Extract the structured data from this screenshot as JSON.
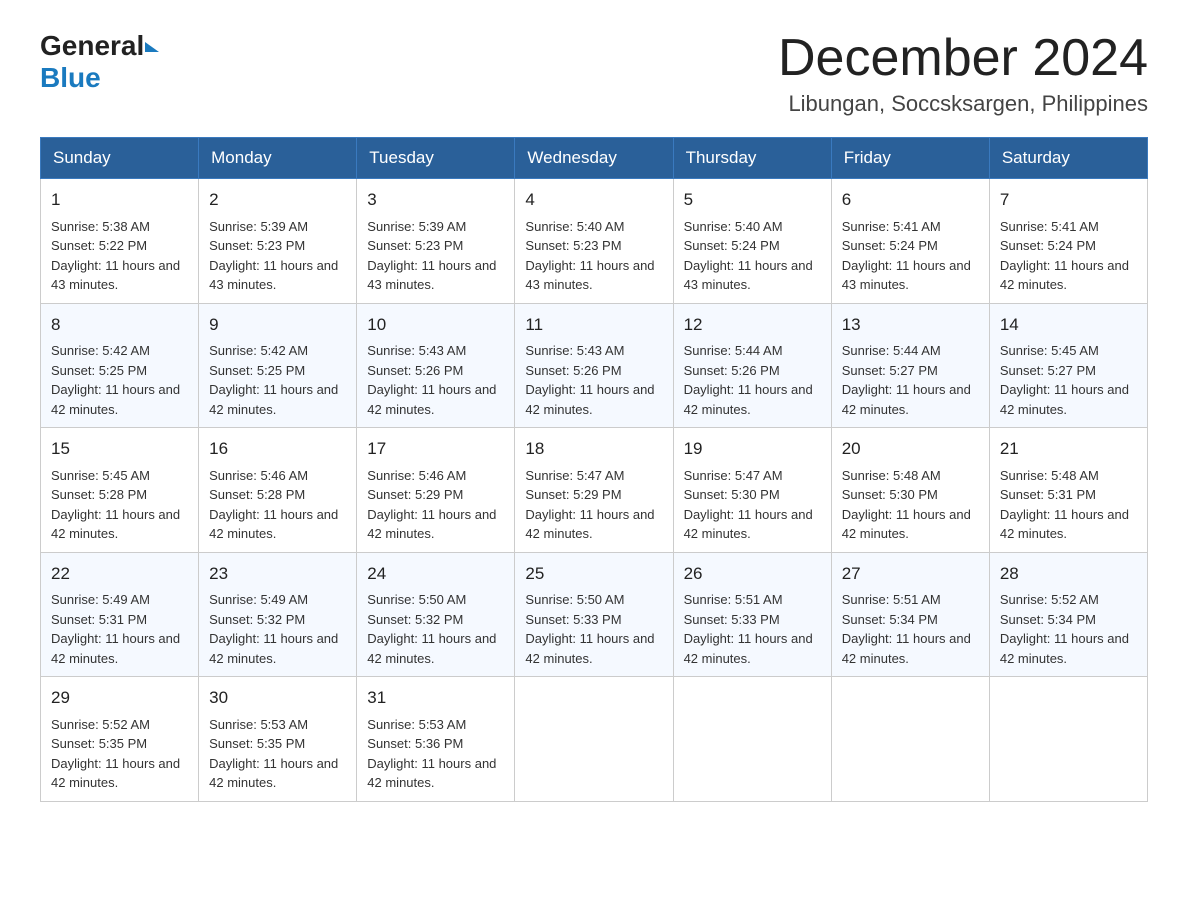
{
  "header": {
    "logo_general": "General",
    "logo_blue": "Blue",
    "month_title": "December 2024",
    "location": "Libungan, Soccsksargen, Philippines"
  },
  "days_of_week": [
    "Sunday",
    "Monday",
    "Tuesday",
    "Wednesday",
    "Thursday",
    "Friday",
    "Saturday"
  ],
  "weeks": [
    [
      {
        "day": "1",
        "sunrise": "5:38 AM",
        "sunset": "5:22 PM",
        "daylight": "11 hours and 43 minutes."
      },
      {
        "day": "2",
        "sunrise": "5:39 AM",
        "sunset": "5:23 PM",
        "daylight": "11 hours and 43 minutes."
      },
      {
        "day": "3",
        "sunrise": "5:39 AM",
        "sunset": "5:23 PM",
        "daylight": "11 hours and 43 minutes."
      },
      {
        "day": "4",
        "sunrise": "5:40 AM",
        "sunset": "5:23 PM",
        "daylight": "11 hours and 43 minutes."
      },
      {
        "day": "5",
        "sunrise": "5:40 AM",
        "sunset": "5:24 PM",
        "daylight": "11 hours and 43 minutes."
      },
      {
        "day": "6",
        "sunrise": "5:41 AM",
        "sunset": "5:24 PM",
        "daylight": "11 hours and 43 minutes."
      },
      {
        "day": "7",
        "sunrise": "5:41 AM",
        "sunset": "5:24 PM",
        "daylight": "11 hours and 42 minutes."
      }
    ],
    [
      {
        "day": "8",
        "sunrise": "5:42 AM",
        "sunset": "5:25 PM",
        "daylight": "11 hours and 42 minutes."
      },
      {
        "day": "9",
        "sunrise": "5:42 AM",
        "sunset": "5:25 PM",
        "daylight": "11 hours and 42 minutes."
      },
      {
        "day": "10",
        "sunrise": "5:43 AM",
        "sunset": "5:26 PM",
        "daylight": "11 hours and 42 minutes."
      },
      {
        "day": "11",
        "sunrise": "5:43 AM",
        "sunset": "5:26 PM",
        "daylight": "11 hours and 42 minutes."
      },
      {
        "day": "12",
        "sunrise": "5:44 AM",
        "sunset": "5:26 PM",
        "daylight": "11 hours and 42 minutes."
      },
      {
        "day": "13",
        "sunrise": "5:44 AM",
        "sunset": "5:27 PM",
        "daylight": "11 hours and 42 minutes."
      },
      {
        "day": "14",
        "sunrise": "5:45 AM",
        "sunset": "5:27 PM",
        "daylight": "11 hours and 42 minutes."
      }
    ],
    [
      {
        "day": "15",
        "sunrise": "5:45 AM",
        "sunset": "5:28 PM",
        "daylight": "11 hours and 42 minutes."
      },
      {
        "day": "16",
        "sunrise": "5:46 AM",
        "sunset": "5:28 PM",
        "daylight": "11 hours and 42 minutes."
      },
      {
        "day": "17",
        "sunrise": "5:46 AM",
        "sunset": "5:29 PM",
        "daylight": "11 hours and 42 minutes."
      },
      {
        "day": "18",
        "sunrise": "5:47 AM",
        "sunset": "5:29 PM",
        "daylight": "11 hours and 42 minutes."
      },
      {
        "day": "19",
        "sunrise": "5:47 AM",
        "sunset": "5:30 PM",
        "daylight": "11 hours and 42 minutes."
      },
      {
        "day": "20",
        "sunrise": "5:48 AM",
        "sunset": "5:30 PM",
        "daylight": "11 hours and 42 minutes."
      },
      {
        "day": "21",
        "sunrise": "5:48 AM",
        "sunset": "5:31 PM",
        "daylight": "11 hours and 42 minutes."
      }
    ],
    [
      {
        "day": "22",
        "sunrise": "5:49 AM",
        "sunset": "5:31 PM",
        "daylight": "11 hours and 42 minutes."
      },
      {
        "day": "23",
        "sunrise": "5:49 AM",
        "sunset": "5:32 PM",
        "daylight": "11 hours and 42 minutes."
      },
      {
        "day": "24",
        "sunrise": "5:50 AM",
        "sunset": "5:32 PM",
        "daylight": "11 hours and 42 minutes."
      },
      {
        "day": "25",
        "sunrise": "5:50 AM",
        "sunset": "5:33 PM",
        "daylight": "11 hours and 42 minutes."
      },
      {
        "day": "26",
        "sunrise": "5:51 AM",
        "sunset": "5:33 PM",
        "daylight": "11 hours and 42 minutes."
      },
      {
        "day": "27",
        "sunrise": "5:51 AM",
        "sunset": "5:34 PM",
        "daylight": "11 hours and 42 minutes."
      },
      {
        "day": "28",
        "sunrise": "5:52 AM",
        "sunset": "5:34 PM",
        "daylight": "11 hours and 42 minutes."
      }
    ],
    [
      {
        "day": "29",
        "sunrise": "5:52 AM",
        "sunset": "5:35 PM",
        "daylight": "11 hours and 42 minutes."
      },
      {
        "day": "30",
        "sunrise": "5:53 AM",
        "sunset": "5:35 PM",
        "daylight": "11 hours and 42 minutes."
      },
      {
        "day": "31",
        "sunrise": "5:53 AM",
        "sunset": "5:36 PM",
        "daylight": "11 hours and 42 minutes."
      },
      null,
      null,
      null,
      null
    ]
  ]
}
